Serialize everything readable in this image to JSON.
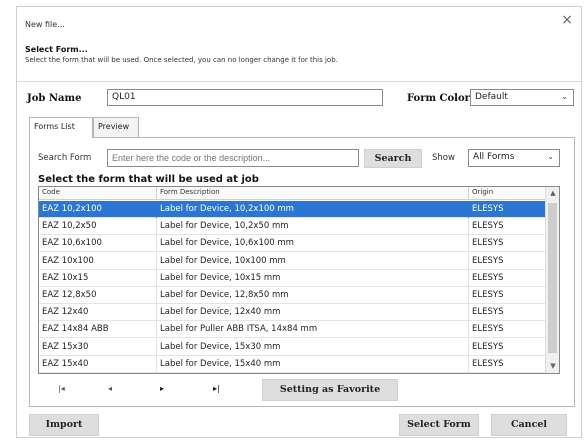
{
  "dialog": {
    "title": "New file...",
    "close_glyph": "×",
    "heading": "Select Form...",
    "description": "Select the form that will be used. Once selected, you can no longer change it for this job."
  },
  "job": {
    "label": "Job Name",
    "value": "QL01"
  },
  "form_color": {
    "label": "Form Color",
    "value": "Default"
  },
  "tabs": [
    {
      "label": "Forms List"
    },
    {
      "label": "Preview"
    }
  ],
  "search": {
    "label": "Search Form",
    "placeholder": "Enter here the code or the description...",
    "button": "Search",
    "show_label": "Show",
    "show_value": "All Forms"
  },
  "grid": {
    "title": "Select the form that will be used at job",
    "columns": [
      "Code",
      "Form Description",
      "Origin"
    ],
    "rows": [
      {
        "code": "EAZ 10,2x100",
        "desc": "Label for Device, 10,2x100 mm",
        "origin": "ELESYS"
      },
      {
        "code": "EAZ 10,2x50",
        "desc": "Label for Device, 10,2x50 mm",
        "origin": "ELESYS"
      },
      {
        "code": "EAZ 10,6x100",
        "desc": "Label for Device, 10,6x100 mm",
        "origin": "ELESYS"
      },
      {
        "code": "EAZ 10x100",
        "desc": "Label for Device, 10x100 mm",
        "origin": "ELESYS"
      },
      {
        "code": "EAZ 10x15",
        "desc": "Label for Device, 10x15 mm",
        "origin": "ELESYS"
      },
      {
        "code": "EAZ 12,8x50",
        "desc": "Label for Device, 12,8x50 mm",
        "origin": "ELESYS"
      },
      {
        "code": "EAZ 12x40",
        "desc": "Label for Device, 12x40 mm",
        "origin": "ELESYS"
      },
      {
        "code": "EAZ 14x84 ABB",
        "desc": "Label for Puller ABB ITSA, 14x84 mm",
        "origin": "ELESYS"
      },
      {
        "code": "EAZ 15x30",
        "desc": "Label for Device, 15x30 mm",
        "origin": "ELESYS"
      },
      {
        "code": "EAZ 15x40",
        "desc": "Label for Device, 15x40 mm",
        "origin": "ELESYS"
      }
    ],
    "selected_index": 0
  },
  "navigation": {
    "first": "|◂",
    "prev": "◂",
    "next": "▸",
    "last": "▸|",
    "favorite_button": "Setting as Favorite"
  },
  "footer": {
    "import_button": "Import",
    "select_button": "Select Form",
    "cancel_button": "Cancel"
  },
  "colors": {
    "selection": "#2b76d2",
    "button_gray": "#dedede"
  }
}
